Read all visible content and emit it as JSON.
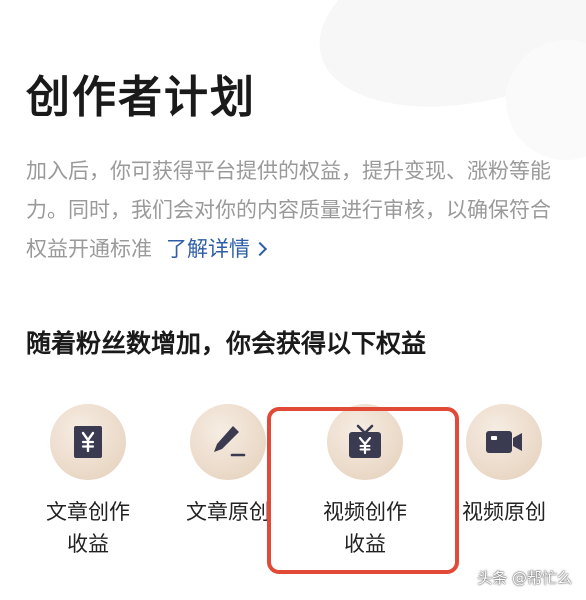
{
  "header": {
    "title": "创作者计划"
  },
  "description": {
    "text": "加入后，你可获得平台提供的权益，提升变现、涨粉等能力。同时，我们会对你的内容质量进行审核，以确保符合权益开通标准",
    "link_label": "了解详情"
  },
  "benefits_section": {
    "title": "随着粉丝数增加，你会获得以下权益",
    "items": [
      {
        "label_line1": "文章创作",
        "label_line2": "收益",
        "icon": "yen-document-icon"
      },
      {
        "label_line1": "文章原创",
        "label_line2": "",
        "icon": "pen-icon"
      },
      {
        "label_line1": "视频创作",
        "label_line2": "收益",
        "icon": "tv-yen-icon",
        "highlighted": true
      },
      {
        "label_line1": "视频原创",
        "label_line2": "",
        "icon": "video-camera-icon"
      }
    ]
  },
  "watermark": {
    "text": "头条 @帮忙么"
  },
  "colors": {
    "link": "#2e5ea8",
    "highlight_border": "#e04a37",
    "icon_fill": "#3a3a50",
    "icon_bg": "#ead8c6"
  }
}
